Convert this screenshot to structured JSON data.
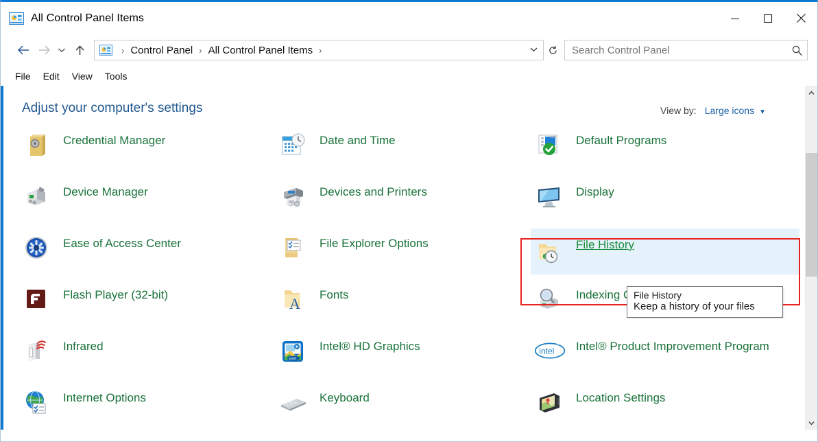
{
  "window": {
    "title": "All Control Panel Items",
    "title_icon": "control-panel-icon",
    "minimize_label": "–",
    "maximize_label": "□",
    "close_label": "✕"
  },
  "navigation": {
    "back_label": "←",
    "forward_label": "→",
    "recent_label": "⌄",
    "up_label": "↑",
    "breadcrumb_icon": "control-panel-icon",
    "breadcrumbs": [
      {
        "label": "Control Panel"
      },
      {
        "label": "All Control Panel Items"
      }
    ],
    "separator": "›",
    "dropdown_caret": "⌄",
    "refresh_label": "↻"
  },
  "search": {
    "placeholder": "Search Control Panel",
    "value": "",
    "icon": "magnifier-icon"
  },
  "menubar": {
    "items": [
      {
        "label": "File"
      },
      {
        "label": "Edit"
      },
      {
        "label": "View"
      },
      {
        "label": "Tools"
      }
    ]
  },
  "page": {
    "heading": "Adjust your computer's settings",
    "view_by_label": "View by:",
    "view_by_value": "Large icons",
    "view_by_caret": "▼"
  },
  "items": [
    [
      {
        "label": "Credential Manager",
        "icon": "credential-manager-icon",
        "highlight": false
      },
      {
        "label": "Date and Time",
        "icon": "date-and-time-icon",
        "highlight": false
      },
      {
        "label": "Default Programs",
        "icon": "default-programs-icon",
        "highlight": false
      }
    ],
    [
      {
        "label": "Device Manager",
        "icon": "device-manager-icon",
        "highlight": false
      },
      {
        "label": "Devices and Printers",
        "icon": "devices-and-printers-icon",
        "highlight": false
      },
      {
        "label": "Display",
        "icon": "display-icon",
        "highlight": false
      }
    ],
    [
      {
        "label": "Ease of Access Center",
        "icon": "ease-of-access-icon",
        "highlight": false
      },
      {
        "label": "File Explorer Options",
        "icon": "file-explorer-options-icon",
        "highlight": false
      },
      {
        "label": "File History",
        "icon": "file-history-icon",
        "highlight": true
      }
    ],
    [
      {
        "label": "Flash Player (32-bit)",
        "icon": "flash-player-icon",
        "highlight": false
      },
      {
        "label": "Fonts",
        "icon": "fonts-icon",
        "highlight": false
      },
      {
        "label": "Indexing Options",
        "icon": "indexing-options-icon",
        "highlight": false
      }
    ],
    [
      {
        "label": "Infrared",
        "icon": "infrared-icon",
        "highlight": false
      },
      {
        "label": "Intel® HD Graphics",
        "icon": "intel-hd-graphics-icon",
        "highlight": false
      },
      {
        "label": "Intel® Product Improvement Program",
        "icon": "intel-logo-icon",
        "highlight": false
      }
    ],
    [
      {
        "label": "Internet Options",
        "icon": "internet-options-icon",
        "highlight": false
      },
      {
        "label": "Keyboard",
        "icon": "keyboard-icon",
        "highlight": false
      },
      {
        "label": "Location Settings",
        "icon": "location-settings-icon",
        "highlight": false
      }
    ]
  ],
  "tooltip": {
    "title": "File History",
    "body": "Keep a history of your files"
  },
  "scrollbar": {
    "up_arrow": "⌃",
    "down_arrow": "⌄"
  },
  "colors": {
    "accent": "#0f7ad4",
    "item_label": "#197239",
    "heading": "#21588f",
    "link": "#2063a8",
    "highlight_bg": "#e5f1fb",
    "annotation": "#e8221f"
  }
}
